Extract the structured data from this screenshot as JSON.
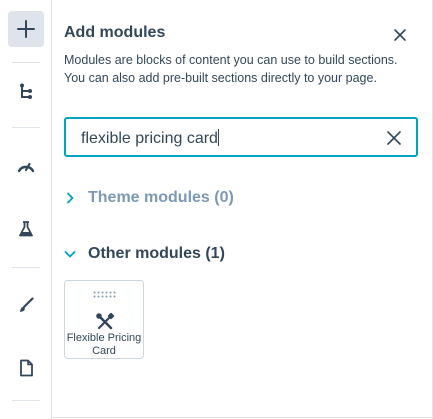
{
  "rail": {
    "items": [
      {
        "icon": "plus-icon",
        "active": true
      },
      {
        "icon": "tree-structure-icon",
        "active": false
      },
      {
        "icon": "gauge-icon",
        "active": false
      },
      {
        "icon": "flask-icon",
        "active": false
      },
      {
        "icon": "brush-icon",
        "active": false
      },
      {
        "icon": "page-icon",
        "active": false
      }
    ]
  },
  "panel": {
    "title": "Add modules",
    "description": "Modules are blocks of content you can use to build sections. You can also add pre-built sections directly to your page."
  },
  "search": {
    "value": "flexible pricing card",
    "accent": "#00a4bd"
  },
  "sections": {
    "theme": {
      "label": "Theme modules (0)",
      "expanded": false
    },
    "other": {
      "label": "Other modules (1)",
      "expanded": true
    }
  },
  "modules": [
    {
      "label": "Flexible Pricing Card",
      "icon": "tools-icon"
    }
  ]
}
